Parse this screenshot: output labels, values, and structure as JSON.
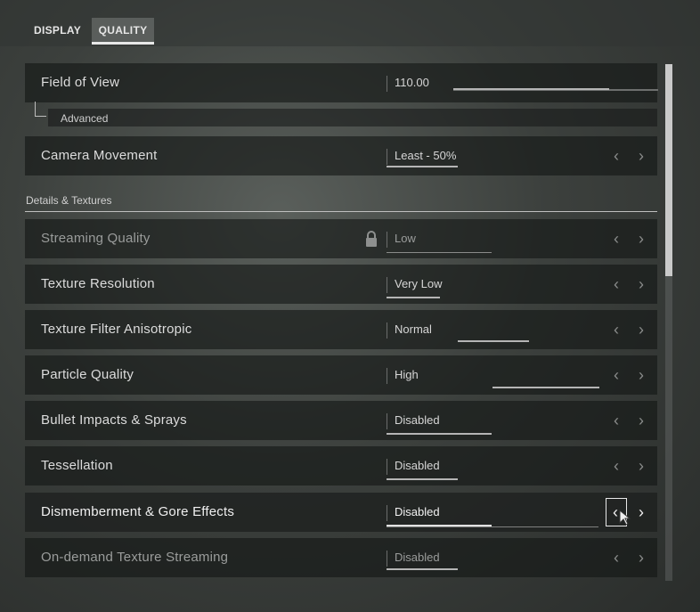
{
  "tabs": [
    {
      "label": "DISPLAY",
      "active": false
    },
    {
      "label": "QUALITY",
      "active": true
    }
  ],
  "fov": {
    "label": "Field of View",
    "value": "110.00",
    "slider_fraction": 0.76
  },
  "advanced_label": "Advanced",
  "camera": {
    "label": "Camera Movement",
    "value": "Least - 50%"
  },
  "section_title": "Details & Textures",
  "settings": [
    {
      "label": "Streaming Quality",
      "value": "Low",
      "locked": true,
      "dim": true,
      "level": "1 of 4"
    },
    {
      "label": "Texture Resolution",
      "value": "Very Low",
      "level": "1 of 4"
    },
    {
      "label": "Texture Filter Anisotropic",
      "value": "Normal",
      "level": "2 of 4"
    },
    {
      "label": "Particle Quality",
      "value": "High",
      "level": "4 of 4"
    },
    {
      "label": "Bullet Impacts & Sprays",
      "value": "Disabled",
      "level": "1 of 2"
    },
    {
      "label": "Tessellation",
      "value": "Disabled",
      "level": "1 of 3"
    },
    {
      "label": "Dismemberment & Gore Effects",
      "value": "Disabled",
      "active": true,
      "level": "1 of 2"
    },
    {
      "label": "On-demand Texture Streaming",
      "value": "Disabled",
      "dim": true,
      "level": "1 of 3"
    }
  ],
  "icons": {
    "left_arrow": "chevron-left-icon",
    "right_arrow": "chevron-right-icon",
    "lock": "lock-icon"
  },
  "colors": {
    "accent": "#e8e8e8",
    "row_bg": "#141615",
    "text": "#dcdcdc",
    "dim_text": "#9a9c9b"
  }
}
